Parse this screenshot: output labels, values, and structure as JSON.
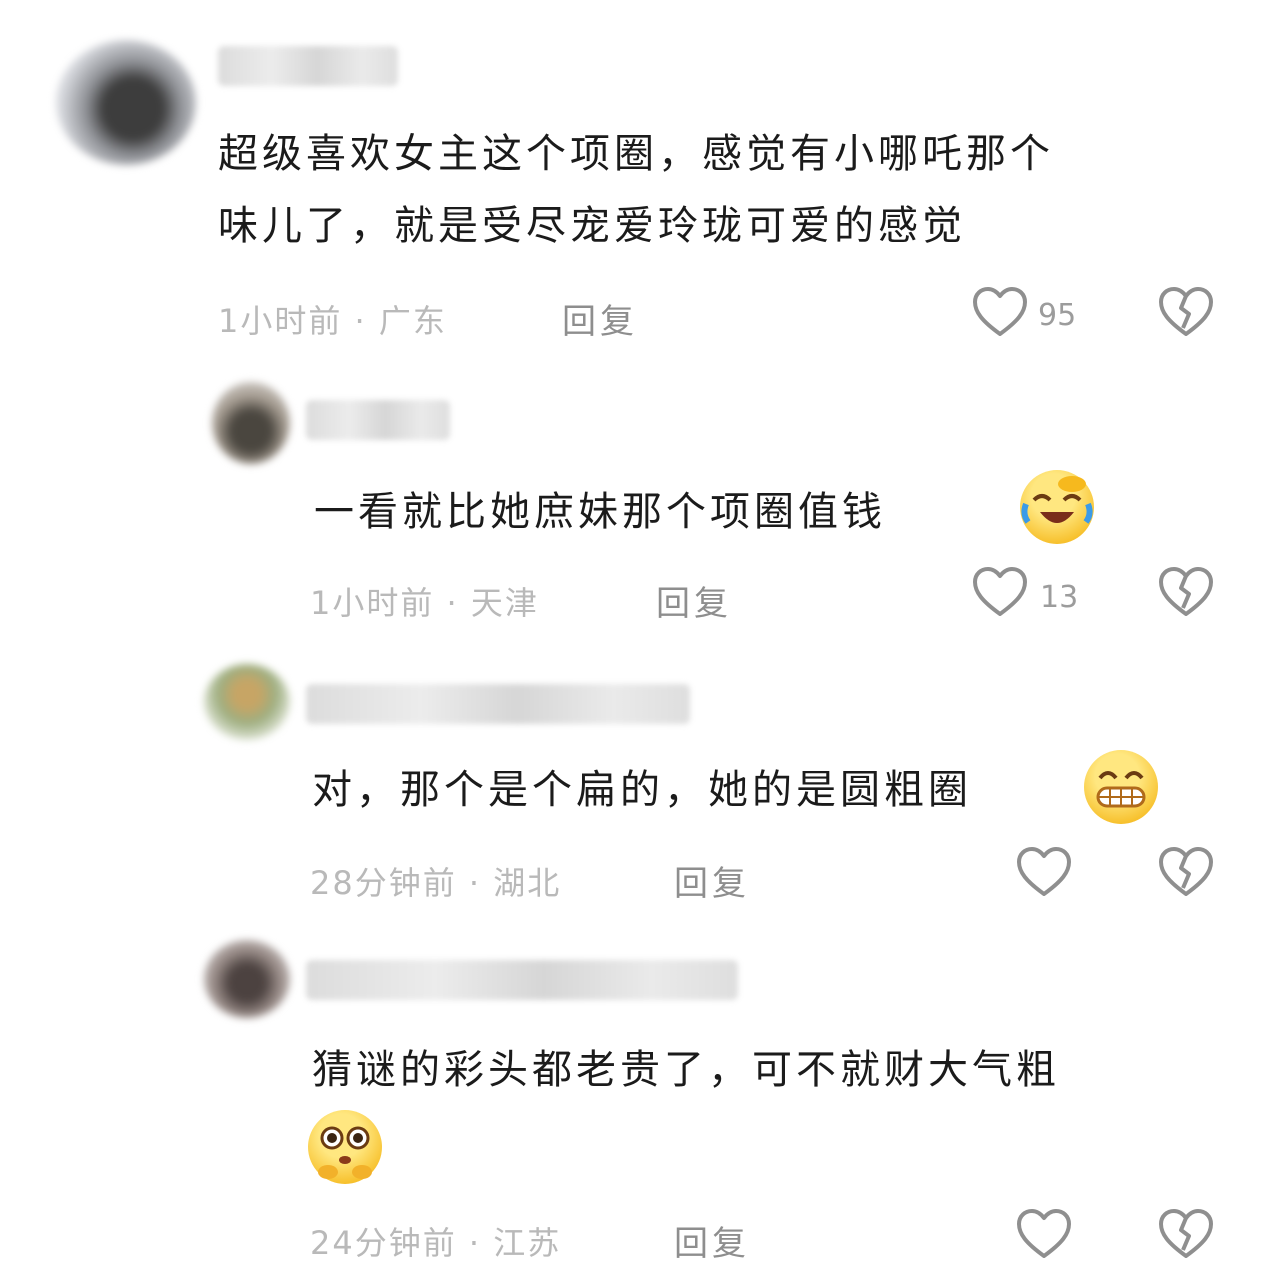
{
  "comments": [
    {
      "text": "超级喜欢女主这个项圈，感觉有小哪吒那个味儿了，就是受尽宠爱玲珑可爱的感觉",
      "text_line1": "超级喜欢女主这个项圈，感觉有小哪吒那个",
      "text_line2": "味儿了，就是受尽宠爱玲珑可爱的感觉",
      "meta": "1小时前 · 广东",
      "reply_label": "回复",
      "likes": "95"
    },
    {
      "text": "一看就比她庶妹那个项圈值钱",
      "meta": "1小时前 · 天津",
      "reply_label": "回复",
      "likes": "13",
      "emoji": "laughing-crying-emoji"
    },
    {
      "text": "对，那个是个扁的，她的是圆粗圈",
      "meta": "28分钟前 · 湖北",
      "reply_label": "回复",
      "emoji": "grinning-emoji"
    },
    {
      "text": "猜谜的彩头都老贵了，可不就财大气粗",
      "meta": "24分钟前 · 江苏",
      "reply_label": "回复",
      "emoji": "pleading-emoji"
    }
  ],
  "icons": {
    "like": "heart-outline-icon",
    "dislike": "broken-heart-icon"
  },
  "colors": {
    "text": "#1b1b1b",
    "meta": "#b9b9b9",
    "reply": "#8e8e8e",
    "icon_stroke": "#8f8f8f"
  }
}
